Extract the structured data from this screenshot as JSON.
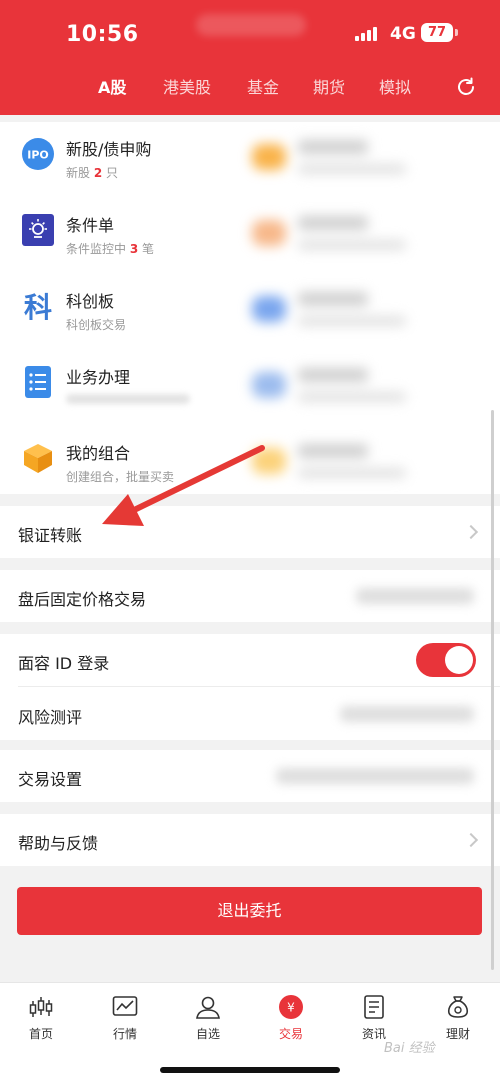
{
  "status": {
    "time": "10:56",
    "network": "4G",
    "battery": "77"
  },
  "tabs": [
    "A股",
    "港美股",
    "基金",
    "期货",
    "模拟"
  ],
  "features": [
    {
      "title": "新股/债申购",
      "sub_prefix": "新股",
      "sub_count": "2",
      "sub_suffix": "只",
      "icon": "ipo-icon",
      "color": "#3b8be8"
    },
    {
      "title": "条件单",
      "sub_prefix": "条件监控中",
      "sub_count": "3",
      "sub_suffix": "笔",
      "icon": "lightbulb-icon",
      "color": "#3a3fb0"
    },
    {
      "title": "科创板",
      "sub_prefix": "科创板交易",
      "sub_count": "",
      "sub_suffix": "",
      "icon": "star-market-icon",
      "color": "#3b7bd4"
    },
    {
      "title": "业务办理",
      "sub_prefix": "",
      "sub_count": "",
      "sub_suffix": "",
      "icon": "list-icon",
      "color": "#3b8be8"
    },
    {
      "title": "我的组合",
      "sub_prefix": "创建组合，批量买卖",
      "sub_count": "",
      "sub_suffix": "",
      "icon": "cube-icon",
      "color": "#f5a623"
    }
  ],
  "ipo_icon_text": "IPO",
  "kc_icon_text": "科",
  "rows": {
    "bank_transfer": "银证转账",
    "after_hours": "盘后固定价格交易",
    "face_id": "面容 ID 登录",
    "risk": "风险测评",
    "trade_settings": "交易设置",
    "help": "帮助与反馈"
  },
  "face_id_enabled": true,
  "logout_label": "退出委托",
  "nav": [
    {
      "label": "首页",
      "icon": "candlestick-icon"
    },
    {
      "label": "行情",
      "icon": "chart-icon"
    },
    {
      "label": "自选",
      "icon": "user-icon"
    },
    {
      "label": "交易",
      "icon": "trade-icon",
      "active": true
    },
    {
      "label": "资讯",
      "icon": "document-icon"
    },
    {
      "label": "理财",
      "icon": "money-bag-icon"
    }
  ],
  "accent_color": "#e8343a",
  "watermark": "Bai 经验"
}
